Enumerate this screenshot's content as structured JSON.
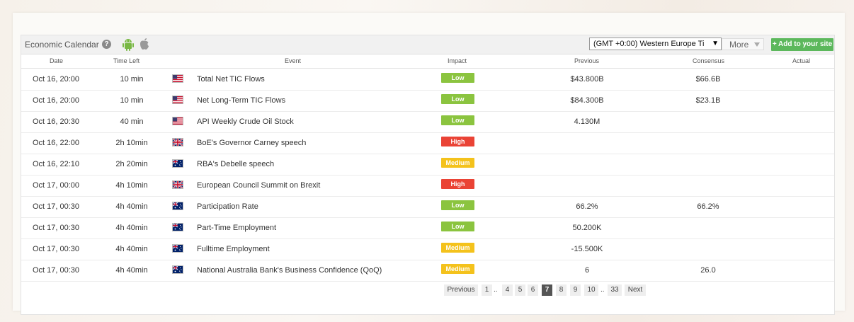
{
  "header": {
    "title": "Economic Calendar",
    "help_icon": "question-circle-icon",
    "timezone": "(GMT +0:00) Western Europe Ti",
    "more_label": "More",
    "add_label": "+ Add to your site"
  },
  "columns": {
    "date": "Date",
    "time_left": "Time Left",
    "event": "Event",
    "impact": "Impact",
    "previous": "Previous",
    "consensus": "Consensus",
    "actual": "Actual"
  },
  "colors": {
    "low": "#8bc43f",
    "high": "#ea4335",
    "medium": "#f4c21c",
    "add_button": "#5cb85c"
  },
  "rows": [
    {
      "date": "Oct 16, 20:00",
      "time_left": "10 min",
      "country": "us",
      "event": "Total Net TIC Flows",
      "impact": "Low",
      "previous": "$43.800B",
      "consensus": "$66.6B",
      "actual": ""
    },
    {
      "date": "Oct 16, 20:00",
      "time_left": "10 min",
      "country": "us",
      "event": "Net Long-Term TIC Flows",
      "impact": "Low",
      "previous": "$84.300B",
      "consensus": "$23.1B",
      "actual": ""
    },
    {
      "date": "Oct 16, 20:30",
      "time_left": "40 min",
      "country": "us",
      "event": "API Weekly Crude Oil Stock",
      "impact": "Low",
      "previous": "4.130M",
      "consensus": "",
      "actual": ""
    },
    {
      "date": "Oct 16, 22:00",
      "time_left": "2h 10min",
      "country": "uk",
      "event": "BoE's Governor Carney speech",
      "impact": "High",
      "previous": "",
      "consensus": "",
      "actual": ""
    },
    {
      "date": "Oct 16, 22:10",
      "time_left": "2h 20min",
      "country": "au",
      "event": "RBA's Debelle speech",
      "impact": "Medium",
      "previous": "",
      "consensus": "",
      "actual": ""
    },
    {
      "date": "Oct 17, 00:00",
      "time_left": "4h 10min",
      "country": "uk",
      "event": "European Council Summit on Brexit",
      "impact": "High",
      "previous": "",
      "consensus": "",
      "actual": ""
    },
    {
      "date": "Oct 17, 00:30",
      "time_left": "4h 40min",
      "country": "au",
      "event": "Participation Rate",
      "impact": "Low",
      "previous": "66.2%",
      "consensus": "66.2%",
      "actual": ""
    },
    {
      "date": "Oct 17, 00:30",
      "time_left": "4h 40min",
      "country": "au",
      "event": "Part-Time Employment",
      "impact": "Low",
      "previous": "50.200K",
      "consensus": "",
      "actual": ""
    },
    {
      "date": "Oct 17, 00:30",
      "time_left": "4h 40min",
      "country": "au",
      "event": "Fulltime Employment",
      "impact": "Medium",
      "previous": "-15.500K",
      "consensus": "",
      "actual": ""
    },
    {
      "date": "Oct 17, 00:30",
      "time_left": "4h 40min",
      "country": "au",
      "event": "National Australia Bank's Business Confidence (QoQ)",
      "impact": "Medium",
      "previous": "6",
      "consensus": "26.0",
      "actual": ""
    }
  ],
  "pagination": {
    "previous": "Previous",
    "next": "Next",
    "pages": [
      "1",
      "..",
      "4",
      "5",
      "6",
      "7",
      "8",
      "9",
      "10",
      "..",
      "33"
    ],
    "current": "7"
  }
}
